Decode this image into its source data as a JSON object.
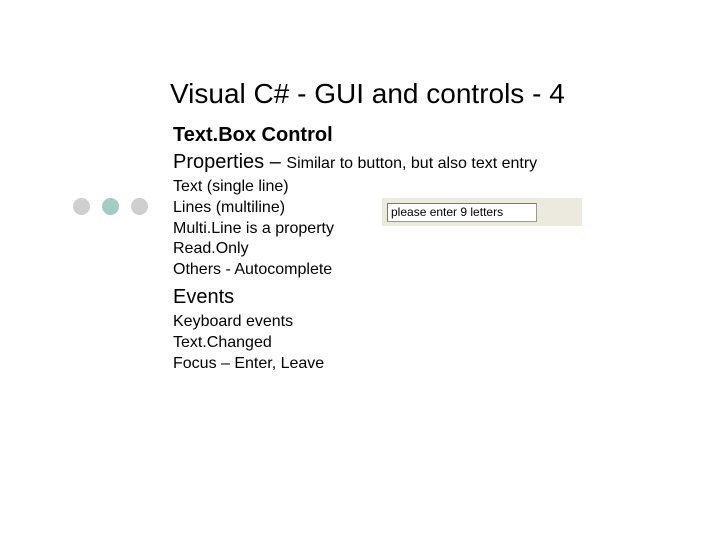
{
  "title": "Visual C# - GUI and controls - 4",
  "section": "Text.Box Control",
  "properties": {
    "label": "Properties – ",
    "detail": "Similar to button, but also text entry",
    "items": [
      "Text (single line)",
      "Lines (multiline)",
      "Multi.Line is a property",
      "Read.Only",
      "Others - Autocomplete"
    ]
  },
  "events": {
    "label": "Events",
    "items": [
      "Keyboard events",
      "Text.Changed",
      "Focus – Enter, Leave"
    ]
  },
  "textbox": {
    "value": "please enter 9 letters"
  }
}
